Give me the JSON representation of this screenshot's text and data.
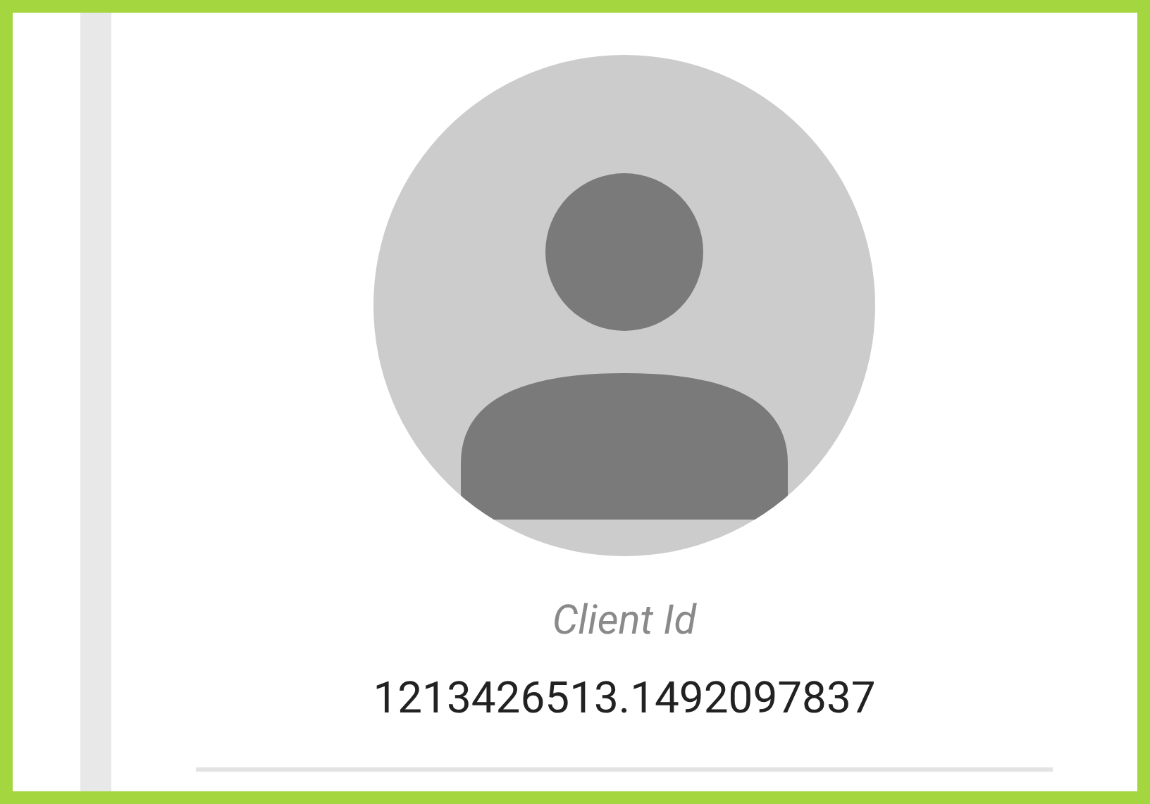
{
  "profile": {
    "label": "Client Id",
    "client_id": "1213426513.1492097837"
  }
}
